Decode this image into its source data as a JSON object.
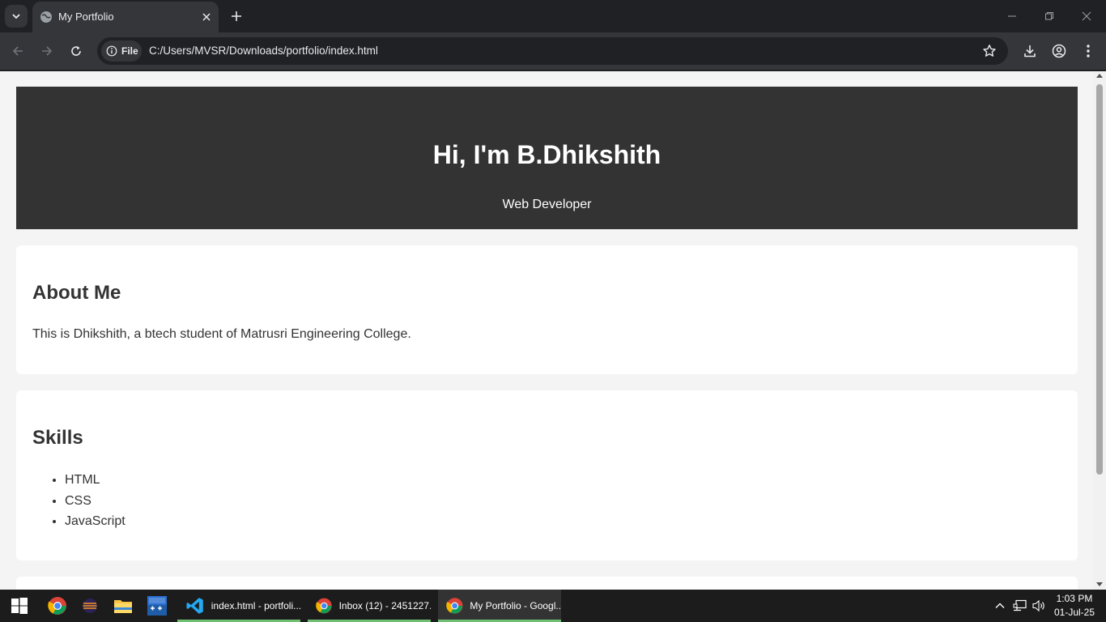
{
  "browser": {
    "tab": {
      "title": "My Portfolio"
    },
    "address": {
      "scheme_label": "File",
      "url": "C:/Users/MVSR/Downloads/portfolio/index.html"
    }
  },
  "page": {
    "hero": {
      "title": "Hi, I'm B.Dhikshith",
      "subtitle": "Web Developer"
    },
    "about": {
      "heading": "About Me",
      "text": "This is Dhikshith, a btech student of Matrusri Engineering College."
    },
    "skills": {
      "heading": "Skills",
      "items": [
        "HTML",
        "CSS",
        "JavaScript"
      ]
    }
  },
  "taskbar": {
    "apps": [
      {
        "label": "index.html - portfoli..."
      },
      {
        "label": "Inbox (12) - 2451227..."
      },
      {
        "label": "My Portfolio - Googl..."
      }
    ],
    "clock": {
      "time": "1:03 PM",
      "date": "01-Jul-25"
    }
  },
  "colors": {
    "hero_bg": "#333333",
    "page_bg": "#f4f4f4",
    "browser_frame": "#202124",
    "toolbar": "#35363a",
    "taskbar_underline": "#6fbf73"
  },
  "icons": [
    "chevron-down-icon",
    "globe-icon",
    "close-icon",
    "plus-icon",
    "minimize-icon",
    "restore-icon",
    "back-icon",
    "forward-icon",
    "reload-icon",
    "info-icon",
    "star-icon",
    "download-icon",
    "profile-icon",
    "menu-icon",
    "windows-start-icon",
    "chrome-icon",
    "eclipse-icon",
    "folder-icon",
    "devcpp-icon",
    "vscode-icon",
    "chevron-up-icon",
    "network-icon",
    "speaker-icon"
  ]
}
